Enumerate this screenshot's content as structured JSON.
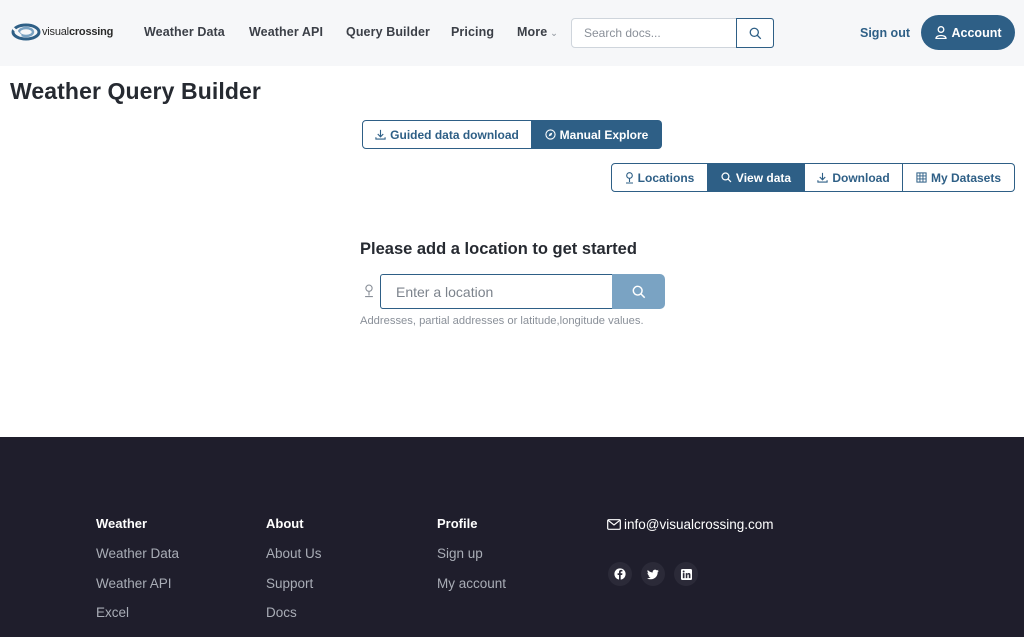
{
  "header": {
    "logo_prefix": "visual",
    "logo_suffix": "crossing",
    "nav": {
      "weather_data": "Weather Data",
      "weather_api": "Weather API",
      "query_builder": "Query Builder",
      "pricing": "Pricing",
      "more": "More"
    },
    "search_placeholder": "Search docs...",
    "sign_out": "Sign out",
    "account": "Account"
  },
  "main": {
    "title": "Weather Query Builder",
    "mode_tabs": [
      "Guided data download",
      "Manual Explore"
    ],
    "view_tabs": [
      "Locations",
      "View data",
      "Download",
      "My Datasets"
    ],
    "prompt": "Please add a location to get started",
    "location_placeholder": "Enter a location",
    "hint": "Addresses, partial addresses or latitude,longitude values."
  },
  "footer": {
    "weather": {
      "heading": "Weather",
      "links": [
        "Weather Data",
        "Weather API",
        "Excel"
      ]
    },
    "about": {
      "heading": "About",
      "links": [
        "About Us",
        "Support",
        "Docs"
      ]
    },
    "profile": {
      "heading": "Profile",
      "links": [
        "Sign up",
        "My account"
      ]
    },
    "email": "info@visualcrossing.com",
    "social_icons": [
      "facebook-icon",
      "twitter-icon",
      "linkedin-icon"
    ]
  },
  "colors": {
    "primary": "#2e5f86",
    "footer_bg": "#1f1e2c",
    "search_button_light": "#7aa3c3"
  }
}
